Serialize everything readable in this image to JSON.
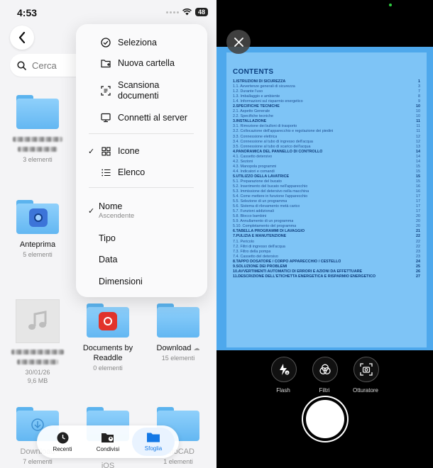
{
  "left": {
    "status": {
      "time": "4:53",
      "battery": "48"
    },
    "search_placeholder": "Cerca",
    "menu": {
      "actions": [
        "Seleziona",
        "Nuova cartella",
        "Scansiona documenti",
        "Connetti al server"
      ],
      "view_options": [
        "Icone",
        "Elenco"
      ],
      "sort_options": [
        "Nome",
        "Tipo",
        "Data",
        "Dimensioni"
      ],
      "sort_sub": "Ascendente"
    },
    "files": [
      {
        "name": "",
        "sub": "3 elementi"
      },
      {
        "name": "Anteprima",
        "sub": "5 elementi"
      },
      {
        "name": "",
        "sub": "30/01/26",
        "sub2": "9,6 MB"
      },
      {
        "name": "Documents by Readdle",
        "sub": "0 elementi"
      },
      {
        "name": "Download",
        "sub": "15 elementi"
      },
      {
        "name": "Download",
        "sub": "7 elementi"
      },
      {
        "name": "iOS",
        "sub": ""
      },
      {
        "name": "AutoCAD",
        "sub": "1 elementi"
      }
    ],
    "tabs": [
      "Recenti",
      "Condivisi",
      "Sfoglia"
    ]
  },
  "right": {
    "doc_title": "CONTENTS",
    "toc": [
      {
        "t": "1.ISTRUZIONI DI SICUREZZA",
        "p": "1",
        "h": true
      },
      {
        "t": "1.1. Avvertenze generali di sicurezza",
        "p": "3",
        "h": false
      },
      {
        "t": "1.2. Durante l'uso",
        "p": "7",
        "h": false
      },
      {
        "t": "1.3. Imballaggio e ambiente",
        "p": "8",
        "h": false
      },
      {
        "t": "1.4. Informazioni sul risparmio energetico",
        "p": "9",
        "h": false
      },
      {
        "t": "2.SPECIFICHE TECNICHE",
        "p": "10",
        "h": true
      },
      {
        "t": "2.1. Aspetto Generale",
        "p": "10",
        "h": false
      },
      {
        "t": "2.2. Specifiche tecniche",
        "p": "10",
        "h": false
      },
      {
        "t": "3.INSTALLAZIONE",
        "p": "11",
        "h": true
      },
      {
        "t": "3.1. Rimozione dei bulloni di trasporto",
        "p": "11",
        "h": false
      },
      {
        "t": "3.2. Collocazione dell'apparecchio e regolazione dei piedini",
        "p": "11",
        "h": false
      },
      {
        "t": "3.3. Connessione elettrica",
        "p": "12",
        "h": false
      },
      {
        "t": "3.4. Connessione al tubo di ingresso dell'acqua",
        "p": "12",
        "h": false
      },
      {
        "t": "3.5. Connessione al tubo di scarico dell'acqua",
        "p": "13",
        "h": false
      },
      {
        "t": "4.PANORAMICA DEL PANNELLO DI CONTROLLO",
        "p": "14",
        "h": true
      },
      {
        "t": "4.1. Cassetto detersivo",
        "p": "14",
        "h": false
      },
      {
        "t": "4.2. Sezioni",
        "p": "14",
        "h": false
      },
      {
        "t": "4.3. Manopola programmi",
        "p": "15",
        "h": false
      },
      {
        "t": "4.4. Indicatori e comandi",
        "p": "15",
        "h": false
      },
      {
        "t": "5.UTILIZZO DELLA LAVATRICE",
        "p": "15",
        "h": true
      },
      {
        "t": "5.1. Preparazione del bucato",
        "p": "15",
        "h": false
      },
      {
        "t": "5.2. Inserimento del bucato nell'apparecchio",
        "p": "16",
        "h": false
      },
      {
        "t": "5.3. Immissione del detersivo nella macchina",
        "p": "16",
        "h": false
      },
      {
        "t": "5.4. Come mettere in funzione l'apparecchio",
        "p": "17",
        "h": false
      },
      {
        "t": "5.5. Selezione di un programma",
        "p": "17",
        "h": false
      },
      {
        "t": "5.6. Sistema di rilevamento metà carico",
        "p": "17",
        "h": false
      },
      {
        "t": "5.7. Funzioni addizionali",
        "p": "17",
        "h": false
      },
      {
        "t": "5.8. Blocco bambini",
        "p": "20",
        "h": false
      },
      {
        "t": "5.9. Annullamento di un programma",
        "p": "20",
        "h": false
      },
      {
        "t": "5.10. Completamento del programma",
        "p": "20",
        "h": false
      },
      {
        "t": "6.TABELLA PROGRAMMI DI LAVAGGIO",
        "p": "21",
        "h": true
      },
      {
        "t": "7.PULIZIA E MANUTENZIONE",
        "p": "22",
        "h": true
      },
      {
        "t": "7.1. Pericolo",
        "p": "22",
        "h": false
      },
      {
        "t": "7.2. Filtri di ingresso dell'acqua",
        "p": "22",
        "h": false
      },
      {
        "t": "7.3. Filtro della pompa",
        "p": "23",
        "h": false
      },
      {
        "t": "7.4. Cassetto del detersivo",
        "p": "23",
        "h": false
      },
      {
        "t": "8.TAPPO DOSATORE / CORPO APPARECCHIO / CESTELLO",
        "p": "24",
        "h": true
      },
      {
        "t": "9.SOLUZIONE DEI PROBLEMI",
        "p": "25",
        "h": true
      },
      {
        "t": "10.AVVERTIMENTI AUTOMATICI DI ERRORI E AZIONI DA EFFETTUARE",
        "p": "26",
        "h": true
      },
      {
        "t": "11.DESCRIZIONE DELL'ETICHETTA ENERGETICA E RISPARMIO ENERGETICO",
        "p": "27",
        "h": true
      }
    ],
    "controls": [
      "Flash",
      "Filtri",
      "Otturatore"
    ]
  }
}
